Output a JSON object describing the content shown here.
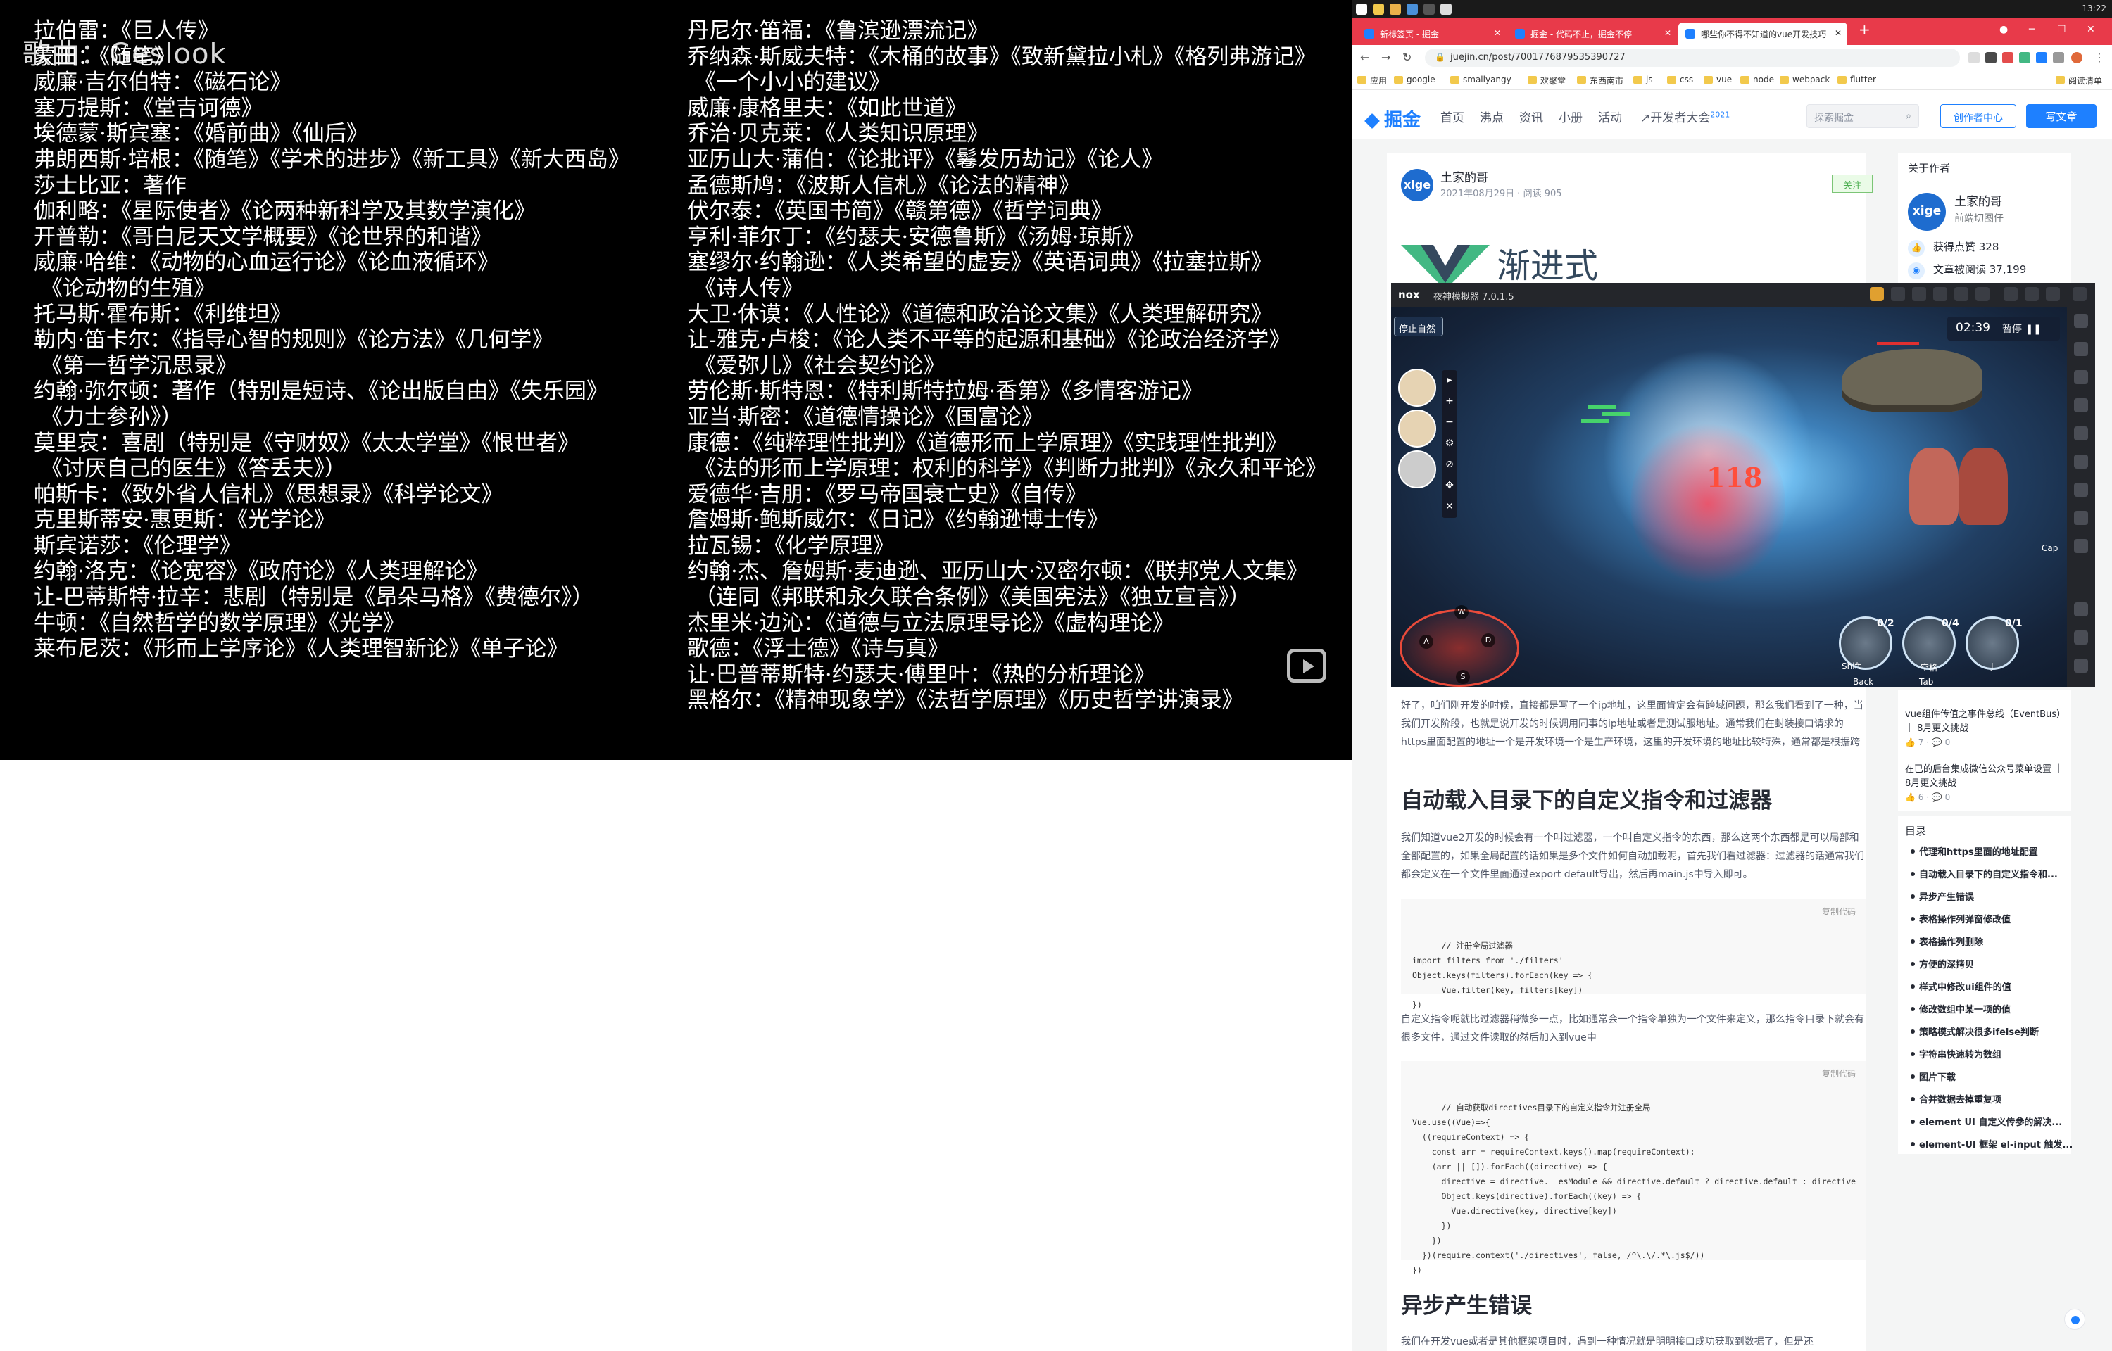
{
  "video": {
    "watermark": "歌曲：Geslook",
    "left_lines": [
      "拉伯雷：《巨人传》",
      "蒙田：《随笔》",
      "威廉·吉尔伯特：《磁石论》",
      "塞万提斯：《堂吉诃德》",
      "埃德蒙·斯宾塞：《婚前曲》《仙后》",
      "弗朗西斯·培根：《随笔》《学术的进步》《新工具》《新大西岛》",
      "莎士比亚：著作",
      "伽利略：《星际使者》《论两种新科学及其数学演化》",
      "开普勒：《哥白尼天文学概要》《论世界的和谐》",
      "威廉·哈维：《动物的心血运行论》《论血液循环》",
      "《论动物的生殖》",
      "托马斯·霍布斯：《利维坦》",
      "勒内·笛卡尔：《指导心智的规则》《论方法》《几何学》",
      "《第一哲学沉思录》",
      "约翰·弥尔顿：著作（特别是短诗、《论出版自由》《失乐园》",
      "《力士参孙》）",
      "莫里哀：喜剧（特别是《守财奴》《太太学堂》《恨世者》",
      "《讨厌自己的医生》《答丢夫》）",
      "帕斯卡：《致外省人信札》《思想录》《科学论文》",
      "克里斯蒂安·惠更斯：《光学论》",
      "斯宾诺莎：《伦理学》",
      "约翰·洛克：《论宽容》《政府论》《人类理解论》",
      "让-巴蒂斯特·拉辛：悲剧（特别是《昂朵马格》《费德尔》）",
      "牛顿：《自然哲学的数学原理》《光学》",
      "莱布尼茨：《形而上学序论》《人类理智新论》《单子论》"
    ],
    "right_lines": [
      "丹尼尔·笛福：《鲁滨逊漂流记》",
      "乔纳森·斯威夫特：《木桶的故事》《致新黛拉小札》《格列弗游记》",
      "《一个小小的建议》",
      "威廉·康格里夫：《如此世道》",
      "乔治·贝克莱：《人类知识原理》",
      "亚历山大·蒲伯：《论批评》《鬈发历劫记》《论人》",
      "孟德斯鸠：《波斯人信札》《论法的精神》",
      "伏尔泰：《英国书简》《赣第德》《哲学词典》",
      "亨利·菲尔丁：《约瑟夫·安德鲁斯》《汤姆·琼斯》",
      "塞缪尔·约翰逊：《人类希望的虚妄》《英语词典》《拉塞拉斯》",
      "《诗人传》",
      "大卫·休谟：《人性论》《道德和政治论文集》《人类理解研究》",
      "让-雅克·卢梭：《论人类不平等的起源和基础》《论政治经济学》",
      "《爱弥儿》《社会契约论》",
      "劳伦斯·斯特恩：《特利斯特拉姆·香第》《多情客游记》",
      "亚当·斯密：《道德情操论》《国富论》",
      "康德：《纯粹理性批判》《道德形而上学原理》《实践理性批判》",
      "《法的形而上学原理：权利的科学》《判断力批判》《永久和平论》",
      "爱德华·吉朋：《罗马帝国衰亡史》《自传》",
      "詹姆斯·鲍斯威尔：《日记》《约翰逊博士传》",
      "拉瓦锡：《化学原理》",
      "约翰·杰、詹姆斯·麦迪逊、亚历山大·汉密尔顿：《联邦党人文集》",
      "（连同《邦联和永久联合条例》《美国宪法》《独立宣言》）",
      "杰里米·边沁：《道德与立法原理导论》《虚构理论》",
      "歌德：《浮士德》《诗与真》",
      "让·巴普蒂斯特·约瑟夫·傅里叶：《热的分析理论》",
      "黑格尔：《精神现象学》《法哲学原理》《历史哲学讲演录》"
    ]
  },
  "os": {
    "clock": "13:22"
  },
  "browser": {
    "tabs": [
      {
        "label": "新标签页 - 掘金",
        "active": false
      },
      {
        "label": "掘金 - 代码不止，掘金不停",
        "active": false
      },
      {
        "label": "哪些你不得不知道的vue开发技巧",
        "active": true
      }
    ],
    "new_tab": "+",
    "url": "juejin.cn/post/7001776879535390727",
    "bookmarks": [
      "应用",
      "google",
      "smallyangy",
      "欢聚堂",
      "东西南市",
      "js",
      "css",
      "vue",
      "node",
      "webpack",
      "flutter",
      "阅读清单"
    ]
  },
  "juejin": {
    "logo": "掘金",
    "nav": [
      "首页",
      "沸点",
      "资讯",
      "小册",
      "活动"
    ],
    "devconf": "开发者大会",
    "devconf_year": "2021",
    "search_placeholder": "探索掘金",
    "creator_center": "创作者中心",
    "write_article": "写文章"
  },
  "article": {
    "avatar_text": "xige",
    "author": "土家酌哥",
    "meta": "2021年08月29日 · 阅读 905",
    "follow": "关注",
    "cover_title": "渐进式",
    "intro": "好了，咱们刚开发的时候，直接都是写了一个ip地址，这里面肯定会有跨域问题，那么我们看到了一种，当我们开发阶段，也就是说开发的时候调用同事的ip地址或者是测试服地址。通常我们在封装接口请求的https里面配置的地址一个是开发环境一个是生产环境，这里的开发环境的地址比较特殊，通常都是根据跨域配置中匹配规则来的，如通常的/api等写法。",
    "h_auto": "自动载入目录下的自定义指令和过滤器",
    "p_auto": "我们知道vue2开发的时候会有一个叫过滤器，一个叫自定义指令的东西，那么这两个东西都是可以局部和全部配置的，如果全局配置的话如果是多个文件如何自动加载呢，首先我们看过滤器：过滤器的话通常我们都会定义在一个文件里面通过export default导出，然后再main.js中导入即可。",
    "copy": "复制代码",
    "code1": "// 注册全局过滤器\nimport filters from './filters'\nObject.keys(filters).forEach(key => {\n      Vue.filter(key, filters[key])\n})",
    "p_directive": "自定义指令呢就比过滤器稍微多一点，比如通常会一个指令单独为一个文件来定义，那么指令目录下就会有很多文件，通过文件读取的然后加入到vue中",
    "code2": "// 自动获取directives目录下的自定义指令并注册全局\nVue.use((Vue)=>{\n  ((requireContext) => {\n    const arr = requireContext.keys().map(requireContext);\n    (arr || []).forEach((directive) => {\n      directive = directive.__esModule && directive.default ? directive.default : directive\n      Object.keys(directive).forEach((key) => {\n        Vue.directive(key, directive[key])\n      })\n    })\n  })(require.context('./directives', false, /^\\.\\/.*\\.js$/))\n})",
    "h_async": "异步产生错误",
    "p_async": "我们在开发vue或者是其他框架项目时，遇到一种情况就是明明接口成功获取到数据了，但是还"
  },
  "sidebar": {
    "about_author": "关于作者",
    "avatar_text": "xige",
    "name": "土家酌哥",
    "role": "前端切图仔",
    "likes": "获得点赞 328",
    "reads": "文章被阅读 37,199",
    "related": [
      {
        "title": "vue组件传值之事件总线（EventBus）｜ 8月更文挑战",
        "likes": "7",
        "comments": "0"
      },
      {
        "title": "在已的后台集成微信公众号菜单设置 ｜ 8月更文挑战",
        "likes": "6",
        "comments": "0"
      }
    ],
    "toc_title": "目录",
    "toc": [
      "代理和https里面的地址配置",
      "自动载入目录下的自定义指令和...",
      "异步产生错误",
      "表格操作列弹窗修改值",
      "表格操作列删除",
      "方便的深拷贝",
      "样式中修改ui组件的值",
      "修改数组中某一项的值",
      "策略模式解决很多ifelse判断",
      "字符串快速转为数组",
      "图片下载",
      "合并数据去掉重复项",
      "element UI 自定义传参的解决...",
      "element-UI 框架 el-input 触发..."
    ]
  },
  "nox": {
    "logo": "nox",
    "title": "夜神模拟器 7.0.1.5",
    "stop": "停止自然",
    "timer": "02:39",
    "pause": "暂停",
    "damage": "118",
    "keys": [
      "W",
      "A",
      "D",
      "S"
    ],
    "skills": [
      {
        "count": "0/2",
        "key": "Shift",
        "label": "Back"
      },
      {
        "count": "0/4",
        "key": "空格",
        "label": "Tab"
      },
      {
        "count": "0/1",
        "key": "J",
        "label": ""
      }
    ],
    "cap": "Cap"
  }
}
